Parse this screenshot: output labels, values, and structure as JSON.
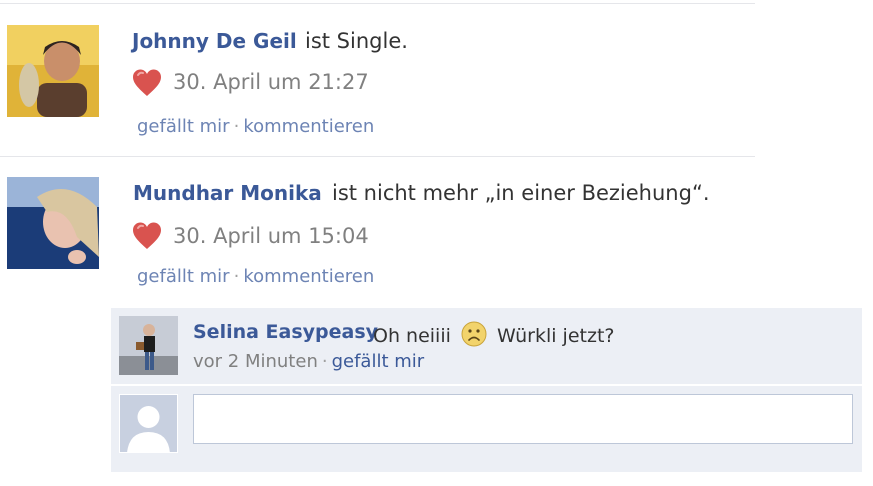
{
  "feed": {
    "stories": [
      {
        "author": "Johnny De Geil",
        "text": "ist Single.",
        "timestamp": "30. April um 21:27",
        "like_label": "gefällt mir",
        "separator": "·",
        "comment_label": "kommentieren"
      },
      {
        "author": "Mundhar Monika",
        "text": "ist nicht mehr „in einer Beziehung“.",
        "timestamp": "30. April um 15:04",
        "like_label": "gefällt mir",
        "separator": "·",
        "comment_label": "kommentieren"
      }
    ],
    "comment": {
      "author": "Selina Easypeasy",
      "text_before": "Oh neiiii",
      "text_after": "Würkli jetzt?",
      "time": "vor 2 Minuten",
      "separator": "·",
      "like_label": "gefällt mir"
    },
    "comment_input": {
      "value": ""
    }
  },
  "colors": {
    "link": "#3b5998",
    "heart": "#d9534f",
    "comment_bg": "#eceff5"
  }
}
